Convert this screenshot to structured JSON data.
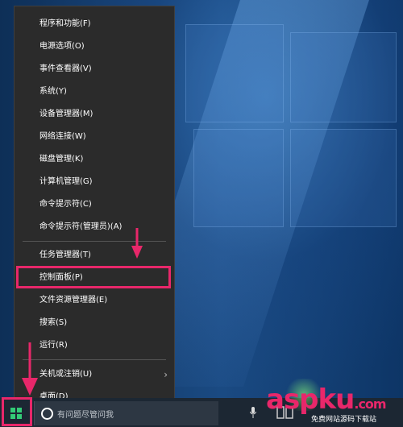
{
  "menu": {
    "items": [
      {
        "label": "程序和功能(F)"
      },
      {
        "label": "电源选项(O)"
      },
      {
        "label": "事件查看器(V)"
      },
      {
        "label": "系统(Y)"
      },
      {
        "label": "设备管理器(M)"
      },
      {
        "label": "网络连接(W)"
      },
      {
        "label": "磁盘管理(K)"
      },
      {
        "label": "计算机管理(G)"
      },
      {
        "label": "命令提示符(C)"
      },
      {
        "label": "命令提示符(管理员)(A)"
      },
      {
        "label": "任务管理器(T)"
      },
      {
        "label": "控制面板(P)"
      },
      {
        "label": "文件资源管理器(E)"
      },
      {
        "label": "搜索(S)"
      },
      {
        "label": "运行(R)"
      },
      {
        "label": "关机或注销(U)"
      },
      {
        "label": "桌面(D)"
      }
    ]
  },
  "taskbar": {
    "search_placeholder": "有问题尽管问我"
  },
  "watermark": {
    "logo_a": "asp",
    "logo_b": "ku",
    "logo_c": ".com",
    "subtext": "免费网站源码下载站"
  },
  "colors": {
    "menu_bg": "#2b2b2b",
    "highlight": "#e8276a",
    "win_logo": "#33cc77"
  }
}
